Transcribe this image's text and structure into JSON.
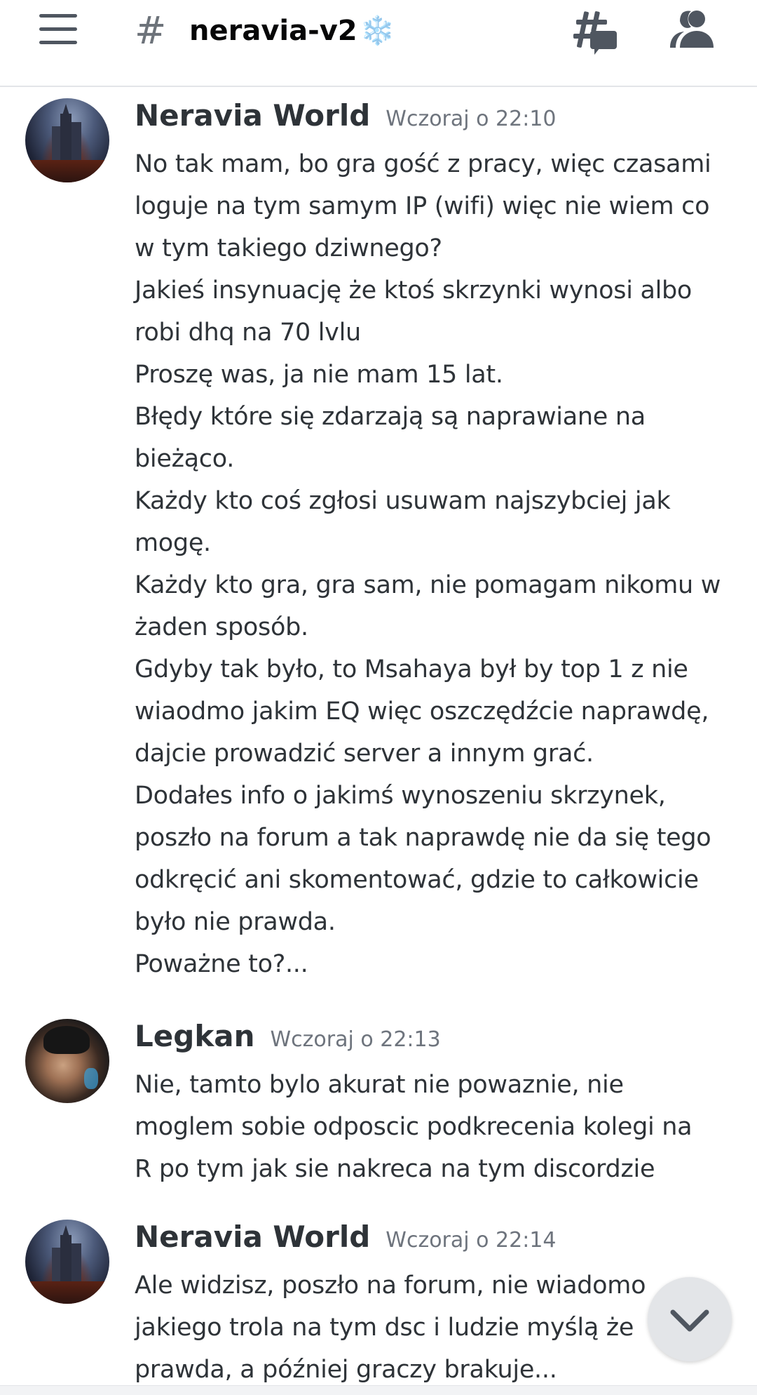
{
  "header": {
    "hash_symbol": "#",
    "channel_name": "neravia-v2",
    "channel_emoji": "❄️",
    "menu_icon": "hamburger-menu-icon",
    "threads_icon": "threads-icon",
    "members_icon": "members-icon"
  },
  "messages": [
    {
      "author": "Neravia World",
      "timestamp": "Wczoraj o 22:10",
      "lines": [
        "No tak mam, bo gra gość z pracy, więc czasami",
        "loguje na tym samym IP (wifi) więc nie wiem co",
        "w tym takiego dziwnego?",
        "Jakieś insynuację że ktoś skrzynki wynosi albo",
        "robi dhq na 70 lvlu",
        "Proszę was, ja nie mam 15 lat.",
        "Błędy które się zdarzają są naprawiane na",
        "bieżąco.",
        "Każdy kto coś zgłosi usuwam najszybciej jak",
        "mogę.",
        "Każdy kto gra, gra sam, nie pomagam nikomu w",
        "żaden sposób.",
        "Gdyby tak było, to Msahaya był by top 1 z nie",
        "wiaodmo jakim EQ więc oszczędźcie naprawdę,",
        "dajcie prowadzić server a innym grać.",
        "Dodałes info o jakimś wynoszeniu skrzynek,",
        "poszło na forum a tak naprawdę nie da się tego",
        "odkręcić ani skomentować, gdzie to całkowicie",
        "było nie prawda.",
        "Poważne to?..."
      ]
    },
    {
      "author": "Legkan",
      "timestamp": "Wczoraj o 22:13",
      "lines": [
        "Nie, tamto bylo akurat nie powaznie, nie",
        "moglem sobie odposcic podkrecenia kolegi na",
        "R po tym jak sie nakreca na tym discordzie"
      ]
    },
    {
      "author": "Neravia World",
      "timestamp": "Wczoraj o 22:14",
      "lines": [
        "Ale widzisz, poszło na forum, nie wiadomo",
        "jakiego trola na tym dsc i ludzie myślą że",
        "prawda, a później graczy brakuje..."
      ]
    }
  ],
  "scroll_button_icon": "chevron-down-icon",
  "colors": {
    "text": "#2e3338",
    "muted": "#6e747d",
    "header_bg": "#ffffff",
    "scroll_button_bg": "#e3e5e8"
  }
}
